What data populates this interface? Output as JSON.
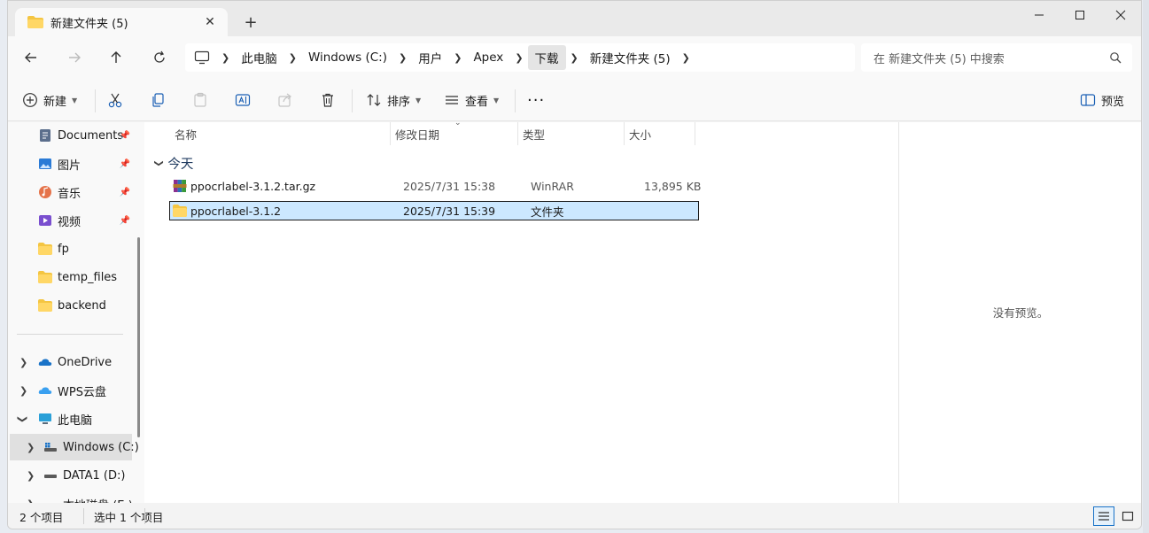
{
  "tab": {
    "title": "新建文件夹 (5)"
  },
  "nav": {
    "breadcrumb": [
      "此电脑",
      "Windows (C:)",
      "用户",
      "Apex",
      "下载",
      "新建文件夹 (5)"
    ],
    "search_placeholder": "在 新建文件夹 (5) 中搜索"
  },
  "commands": {
    "new_label": "新建",
    "sort_label": "排序",
    "view_label": "查看",
    "preview_label": "预览"
  },
  "sidebar": {
    "quick": [
      "Documents",
      "图片",
      "音乐",
      "视频",
      "fp",
      "temp_files",
      "backend"
    ],
    "roots": [
      "OneDrive",
      "WPS云盘",
      "此电脑",
      "Windows (C:)",
      "DATA1 (D:)",
      "本地磁盘 (E:)"
    ]
  },
  "columns": {
    "name": "名称",
    "modified": "修改日期",
    "type": "类型",
    "size": "大小"
  },
  "group": {
    "label": "今天"
  },
  "files": [
    {
      "name": "ppocrlabel-3.1.2.tar.gz",
      "modified": "2025/7/31 15:38",
      "type": "WinRAR",
      "size": "13,895 KB"
    },
    {
      "name": "ppocrlabel-3.1.2",
      "modified": "2025/7/31 15:39",
      "type": "文件夹",
      "size": ""
    }
  ],
  "preview": {
    "empty_text": "没有预览。"
  },
  "status": {
    "count": "2 个项目",
    "selection": "选中 1 个项目"
  },
  "colors": {
    "accent": "#0067c0",
    "selection": "#cce8ff",
    "folder": "#f4c542"
  }
}
